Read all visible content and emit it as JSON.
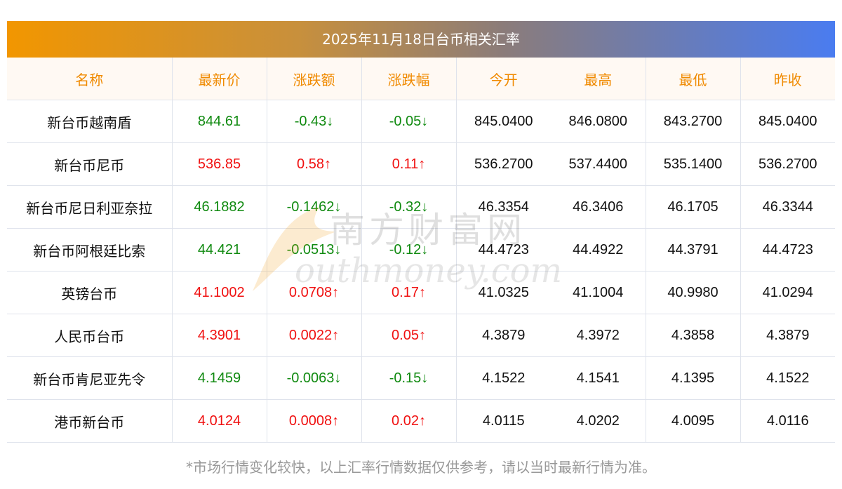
{
  "title": "2025年11月18日台币相关汇率",
  "headers": [
    "名称",
    "最新价",
    "涨跌额",
    "涨跌幅",
    "今开",
    "最高",
    "最低",
    "昨收"
  ],
  "rows": [
    {
      "name": "新台币越南盾",
      "price": "844.61",
      "change": "-0.43↓",
      "pct": "-0.05↓",
      "open": "845.0400",
      "high": "846.0800",
      "low": "843.2700",
      "prev": "845.0400",
      "dir": "down"
    },
    {
      "name": "新台币尼币",
      "price": "536.85",
      "change": "0.58↑",
      "pct": "0.11↑",
      "open": "536.2700",
      "high": "537.4400",
      "low": "535.1400",
      "prev": "536.2700",
      "dir": "up"
    },
    {
      "name": "新台币尼日利亚奈拉",
      "price": "46.1882",
      "change": "-0.1462↓",
      "pct": "-0.32↓",
      "open": "46.3354",
      "high": "46.3406",
      "low": "46.1705",
      "prev": "46.3344",
      "dir": "down"
    },
    {
      "name": "新台币阿根廷比索",
      "price": "44.421",
      "change": "-0.0513↓",
      "pct": "-0.12↓",
      "open": "44.4723",
      "high": "44.4922",
      "low": "44.3791",
      "prev": "44.4723",
      "dir": "down"
    },
    {
      "name": "英镑台币",
      "price": "41.1002",
      "change": "0.0708↑",
      "pct": "0.17↑",
      "open": "41.0325",
      "high": "41.1004",
      "low": "40.9980",
      "prev": "41.0294",
      "dir": "up"
    },
    {
      "name": "人民币台币",
      "price": "4.3901",
      "change": "0.0022↑",
      "pct": "0.05↑",
      "open": "4.3879",
      "high": "4.3972",
      "low": "4.3858",
      "prev": "4.3879",
      "dir": "up"
    },
    {
      "name": "新台币肯尼亚先令",
      "price": "4.1459",
      "change": "-0.0063↓",
      "pct": "-0.15↓",
      "open": "4.1522",
      "high": "4.1541",
      "low": "4.1395",
      "prev": "4.1522",
      "dir": "down"
    },
    {
      "name": "港币新台币",
      "price": "4.0124",
      "change": "0.0008↑",
      "pct": "0.02↑",
      "open": "4.0115",
      "high": "4.0202",
      "low": "4.0095",
      "prev": "4.0116",
      "dir": "up"
    }
  ],
  "watermark": {
    "cn": "南方财富网",
    "en": "southmoney.com"
  },
  "footer": "*市场行情变化较快，以上汇率行情数据仅供参考，请以当时最新行情为准。",
  "colors": {
    "up": "#f01010",
    "down": "#108a10",
    "header": "#f08a00"
  }
}
